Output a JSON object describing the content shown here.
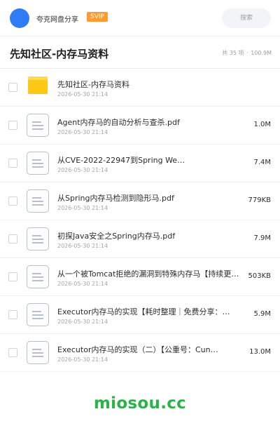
{
  "header": {
    "username": "夸克网盘分享",
    "badge": "SVIP",
    "search_placeholder": "搜索"
  },
  "folder": {
    "title": "先知社区-内存马资料",
    "count_text": "共 35 项",
    "separator": "·",
    "total_size": "100.9M"
  },
  "files": [
    {
      "type": "folder",
      "name": "先知社区-内存马资料",
      "date": "2026-05-30 21:14",
      "size": ""
    },
    {
      "type": "pdf",
      "name": "Agent内存马的自动分析与查杀.pdf",
      "date": "2026-05-30 21:14",
      "size": "1.0M"
    },
    {
      "type": "pdf",
      "name": "从CVE-2022-22947到Spring We…",
      "date": "2026-05-30 21:14",
      "size": "7.4M"
    },
    {
      "type": "pdf",
      "name": "从Spring内存马检测到隐形马.pdf",
      "date": "2026-05-30 21:14",
      "size": "779KB"
    },
    {
      "type": "pdf",
      "name": "初探Java安全之Spring内存马.pdf",
      "date": "2026-05-30 21:14",
      "size": "7.9M"
    },
    {
      "type": "pdf",
      "name": "从一个被Tomcat拒绝的漏洞到特殊内存马【持续更…",
      "date": "2026-05-30 21:14",
      "size": "503KB"
    },
    {
      "type": "pdf",
      "name": "Executor内存马的实现【耗时整理｜免费分享：…",
      "date": "2026-05-30 21:14",
      "size": "5.9M"
    },
    {
      "type": "pdf",
      "name": "Executor内存马的实现（二）【公重号：Cun…",
      "date": "2026-05-30 21:14",
      "size": "13.0M"
    }
  ],
  "footer": {
    "brand": "miosou.cc"
  },
  "colors": {
    "accent_blue": "#2f7df6",
    "svip_orange": "#ff9b2f",
    "folder_yellow": "#ffc815",
    "brand_green": "#28b446"
  },
  "icons": {
    "folder": "folder-icon",
    "pdf": "document-icon"
  }
}
